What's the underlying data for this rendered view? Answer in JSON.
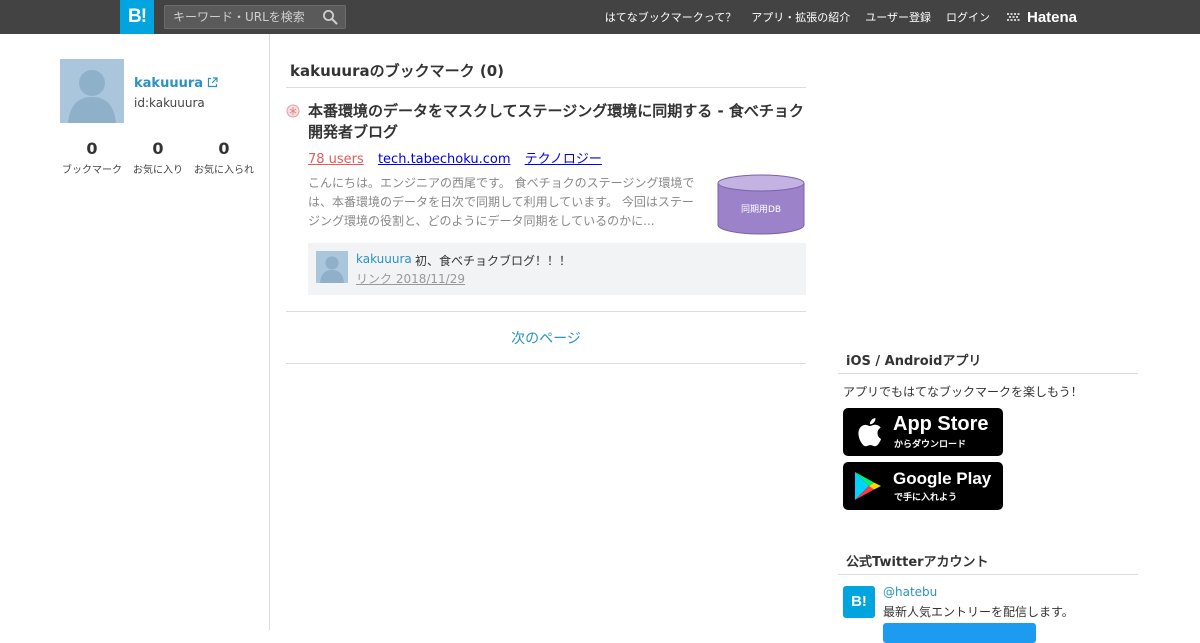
{
  "header": {
    "logo_text": "B!",
    "search_placeholder": "キーワード・URLを検索",
    "nav": [
      "はてなブックマークって？",
      "アプリ・拡張の紹介",
      "ユーザー登録",
      "ログイン"
    ],
    "brand": "Hatena"
  },
  "profile": {
    "name": "kakuuura",
    "id": "id:kakuuura",
    "stats": [
      {
        "value": "0",
        "label": "ブックマーク"
      },
      {
        "value": "0",
        "label": "お気に入り"
      },
      {
        "value": "0",
        "label": "お気に入られ"
      }
    ]
  },
  "main": {
    "title": "kakuuuraのブックマーク (0)",
    "entry": {
      "title": "本番環境のデータをマスクしてステージング環境に同期する - 食べチョク開発者ブログ",
      "users": "78 users",
      "domain": "tech.tabechoku.com",
      "category": "テクノロジー",
      "summary": "こんにちは。エンジニアの西尾です。 食べチョクのステージング環境では、本番環境のデータを日次で同期して利用しています。 今回はステージング環境の役割と、どのようにデータ同期をしているのかに...",
      "thumb_label": "同期用DB",
      "comment": {
        "user": "kakuuura",
        "text": "初、食べチョクブログ！！！",
        "date": "リンク 2018/11/29"
      }
    },
    "next_page": "次のページ"
  },
  "sidebar": {
    "apps_title": "iOS / Androidアプリ",
    "apps_text": "アプリでもはてなブックマークを楽しもう！",
    "app_store": {
      "main": "App Store",
      "sub": "からダウンロード"
    },
    "google_play": {
      "main": "Google Play",
      "sub": "で手に入れよう"
    },
    "twitter_title": "公式Twitterアカウント",
    "twitter_logo": "B!",
    "twitter_handle": "@hatebu",
    "twitter_desc": "最新人気エントリーを配信します。"
  },
  "colors": {
    "accent": "#00a4de",
    "link": "#2a93c4",
    "users": "#e55a5a",
    "topbar": "#434343"
  }
}
